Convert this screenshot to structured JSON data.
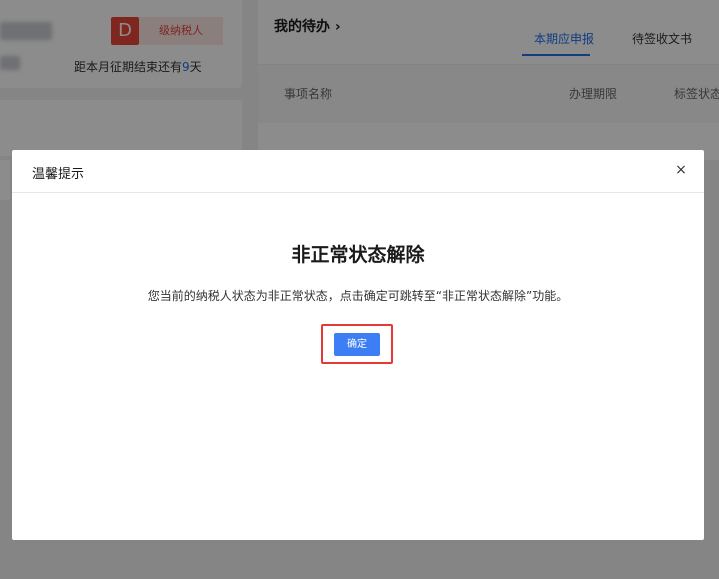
{
  "background": {
    "left_card": {
      "avatar_letter": "D",
      "taxpayer_badge": "级纳税人",
      "period_prefix": "距本月征期结束还有",
      "period_days": "9",
      "period_suffix": "天"
    },
    "todo": {
      "title": "我的待办 ›",
      "tabs": [
        {
          "label": "本期应申报",
          "active": true
        },
        {
          "label": "待签收文书",
          "active": false
        }
      ],
      "columns": [
        "事项名称",
        "办理期限",
        "标签状态"
      ]
    }
  },
  "modal": {
    "title": "温馨提示",
    "close_symbol": "×",
    "heading": "非正常状态解除",
    "message": "您当前的纳税人状态为非正常状态，点击确定可跳转至“非正常状态解除”功能。",
    "confirm_label": "确定"
  },
  "colors": {
    "accent": "#3d7ef4",
    "highlight": "#e53935",
    "badge_red": "#e8463a"
  }
}
